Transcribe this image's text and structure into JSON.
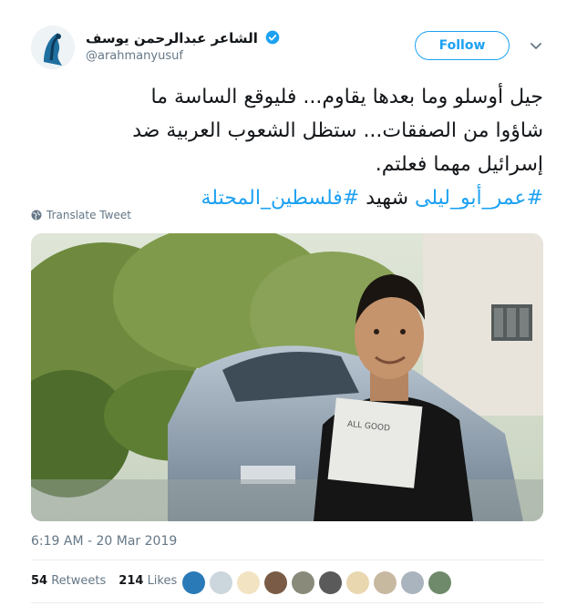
{
  "author": {
    "display_name": "الشاعر عبدالرحمن يوسف",
    "handle": "@arahmanyusuf",
    "verified": true,
    "avatar_icon": "poet-avatar-icon"
  },
  "follow_label": "Follow",
  "tweet": {
    "lines": [
      "جيل أوسلو وما بعدها يقاوم... فليوقع الساسة ما",
      "شاؤوا من الصفقات... ستظل الشعوب العربية ضد",
      "إسرائيل مهما فعلتم."
    ],
    "last_line": {
      "hashtag1": "#عمر_أبو_ليلى",
      "word": "شهيد",
      "hashtag2": "#فلسطين_المحتلة"
    }
  },
  "translate_label": "Translate Tweet",
  "timestamp": "6:19 AM - 20 Mar 2019",
  "stats": {
    "retweets_count": "54",
    "retweets_label": "Retweets",
    "likes_count": "214",
    "likes_label": "Likes"
  },
  "colors": {
    "accent": "#1da1f2",
    "muted": "#657786"
  }
}
